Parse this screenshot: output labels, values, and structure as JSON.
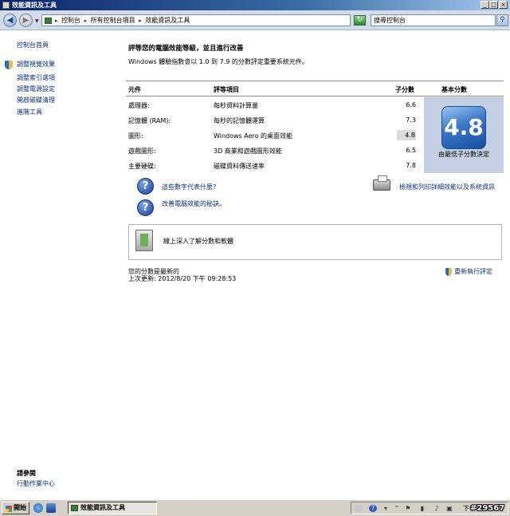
{
  "window": {
    "title": "效能資訊及工具",
    "minimize_label": "_",
    "maximize_label": "□",
    "close_label": "×"
  },
  "address_bar": {
    "crumbs": [
      "控制台",
      "所有控制台項目",
      "效能資訊及工具"
    ],
    "separator": "▸",
    "search_placeholder": "搜尋控制台"
  },
  "sidebar": {
    "items": [
      {
        "label": "控制台首頁"
      },
      {
        "label": "調整視覺效果"
      },
      {
        "label": "調整索引選項"
      },
      {
        "label": "調整電源設定"
      },
      {
        "label": "開啟磁碟清理"
      },
      {
        "label": "進階工具"
      }
    ],
    "see_also_title": "請參閱",
    "see_also_items": [
      {
        "label": "行動作業中心"
      }
    ]
  },
  "main": {
    "heading": "評等您的電腦效能等級，並且進行改善",
    "intro": "Windows 體驗指數會以 1.0 到 7.9 的分數評定重要系統元件。",
    "table": {
      "headers": {
        "component": "元件",
        "rating": "評等項目",
        "subscore": "子分數",
        "basescore": "基本分數"
      },
      "rows": [
        {
          "component": "處理器:",
          "rating": "每秒資料計算量",
          "subscore": "6.6"
        },
        {
          "component": "記憶體 (RAM):",
          "rating": "每秒的記憶體運算",
          "subscore": "7.3"
        },
        {
          "component": "圖形:",
          "rating": "Windows Aero 的桌面效能",
          "subscore": "4.8"
        },
        {
          "component": "遊戲圖形:",
          "rating": "3D 商業和遊戲圖形效能",
          "subscore": "6.5"
        },
        {
          "component": "主要硬碟:",
          "rating": "磁碟資料傳送速率",
          "subscore": "7.8"
        }
      ],
      "base_score": "4.8",
      "base_caption": "由最低子分數決定"
    },
    "help_links": [
      {
        "label": "這些數字代表什麼?"
      },
      {
        "label": "改善電腦效能的秘訣。"
      }
    ],
    "print_link": "檢視和列印詳細效能以及系統資訊",
    "learn_more": "線上深入了解分數和軟體",
    "status_line1": "您的分數是最新的",
    "status_line2": "上次更新: 2012/8/20 下午 09:28:53",
    "rerun_label": "重新執行評定"
  },
  "taskbar": {
    "start_label": "開始",
    "task_label": "效能資訊及工具",
    "clock": "下午",
    "watermark": "#29567"
  }
}
